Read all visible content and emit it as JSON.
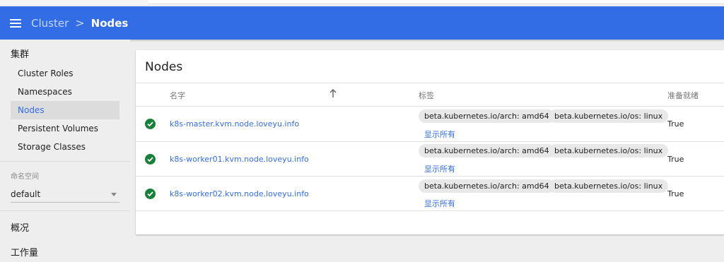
{
  "header": {
    "breadcrumb_parent": "Cluster",
    "breadcrumb_separator": ">",
    "breadcrumb_current": "Nodes"
  },
  "sidebar": {
    "cluster_section": "集群",
    "items": [
      {
        "label": "Cluster Roles"
      },
      {
        "label": "Namespaces"
      },
      {
        "label": "Nodes",
        "active": true
      },
      {
        "label": "Persistent Volumes"
      },
      {
        "label": "Storage Classes"
      }
    ],
    "namespace_label": "命名空间",
    "namespace_value": "default",
    "overview_section": "概况",
    "workloads_section": "工作量"
  },
  "card": {
    "title": "Nodes",
    "columns": {
      "name": "名字",
      "labels": "标签",
      "ready": "准备就绪"
    },
    "rows": [
      {
        "name": "k8s-master.kvm.node.loveyu.info",
        "labels": [
          "beta.kubernetes.io/arch: amd64",
          "beta.kubernetes.io/os: linux"
        ],
        "show_all": "显示所有",
        "ready": "True"
      },
      {
        "name": "k8s-worker01.kvm.node.loveyu.info",
        "labels": [
          "beta.kubernetes.io/arch: amd64",
          "beta.kubernetes.io/os: linux"
        ],
        "show_all": "显示所有",
        "ready": "True"
      },
      {
        "name": "k8s-worker02.kvm.node.loveyu.info",
        "labels": [
          "beta.kubernetes.io/arch: amd64",
          "beta.kubernetes.io/os: linux"
        ],
        "show_all": "显示所有",
        "ready": "True"
      }
    ]
  },
  "icons": {
    "menu": "menu-icon",
    "sort": "arrow-up-icon",
    "status": "check-circle-icon",
    "dropdown": "chevron-down-icon"
  },
  "colors": {
    "brand": "#326de6",
    "success": "#188038",
    "link": "#326de6"
  }
}
